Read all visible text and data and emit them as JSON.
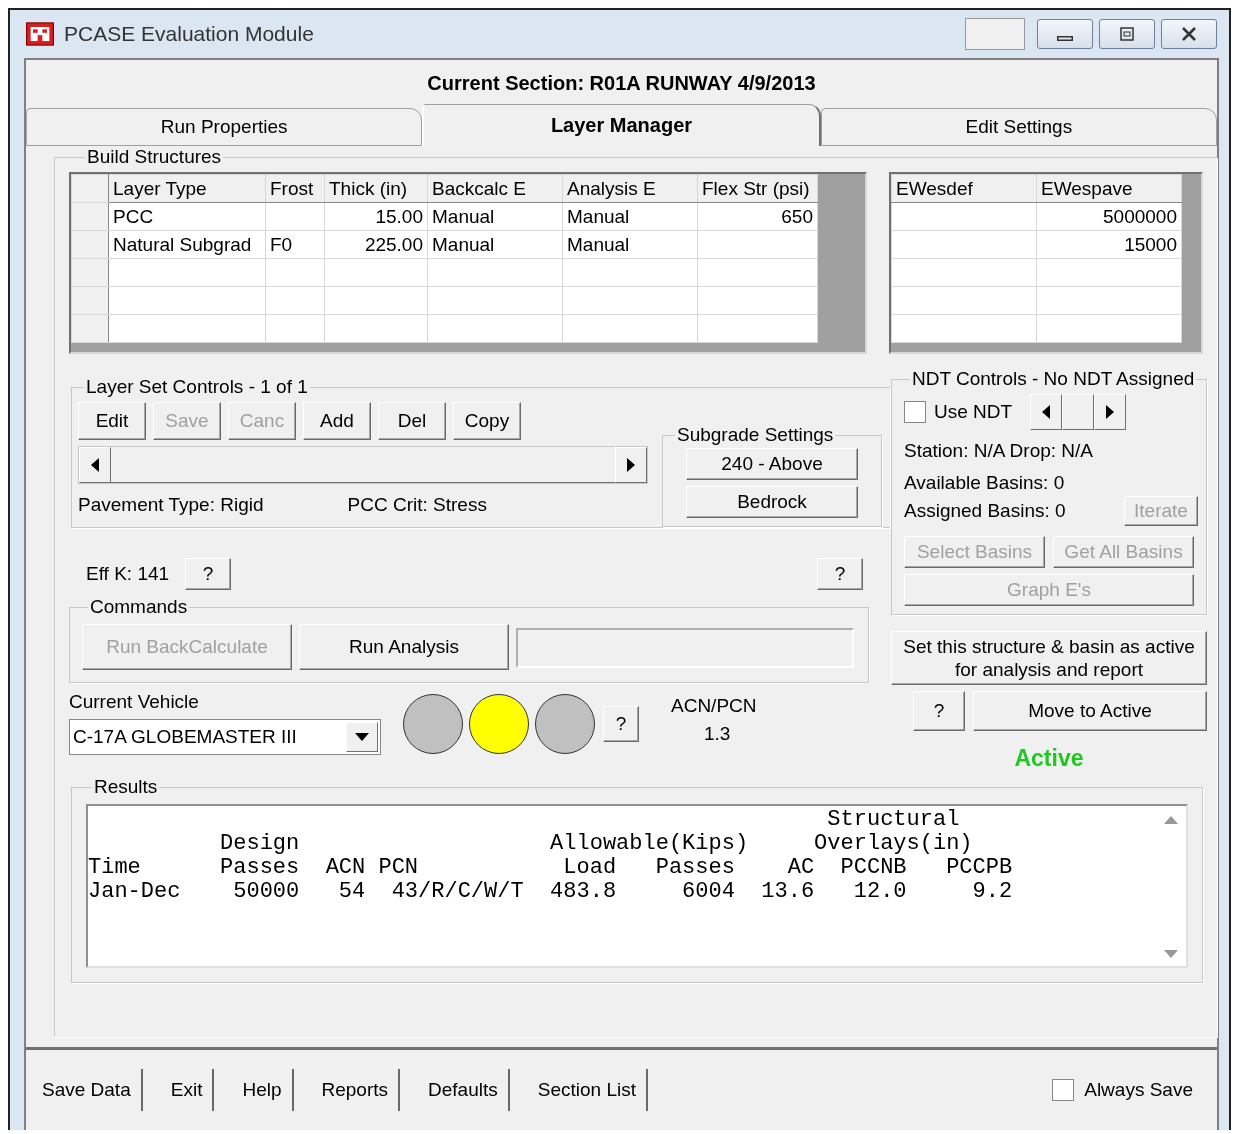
{
  "window": {
    "title": "PCASE Evaluation Module"
  },
  "header": "Current Section: R01A RUNWAY 4/9/2013",
  "tabs": [
    {
      "label": "Run Properties",
      "selected": false
    },
    {
      "label": "Layer Manager",
      "selected": true
    },
    {
      "label": "Edit Settings",
      "selected": false
    }
  ],
  "build_structures": {
    "title": "Build Structures",
    "layer_table": {
      "columns": [
        {
          "label": "Layer Type"
        },
        {
          "label": "Frost"
        },
        {
          "label": "Thick (in)"
        },
        {
          "label": "Backcalc E"
        },
        {
          "label": "Analysis E"
        },
        {
          "label": "Flex Str (psi)"
        }
      ],
      "rows": [
        [
          "PCC",
          null,
          "15.00",
          "Manual",
          "Manual",
          "650"
        ],
        [
          "Natural Subgrad",
          "F0",
          "225.00",
          "Manual",
          "Manual",
          null
        ]
      ]
    },
    "e_table": {
      "columns": [
        {
          "label": "EWesdef"
        },
        {
          "label": "EWespave"
        }
      ],
      "rows": [
        [
          null,
          "5000000"
        ],
        [
          null,
          "15000"
        ]
      ]
    }
  },
  "layer_set_controls": {
    "title": "Layer Set Controls - 1 of 1",
    "buttons": [
      {
        "label": "Edit",
        "disabled": false
      },
      {
        "label": "Save",
        "disabled": true
      },
      {
        "label": "Canc",
        "disabled": true
      },
      {
        "label": "Add",
        "disabled": false
      },
      {
        "label": "Del",
        "disabled": false
      },
      {
        "label": "Copy",
        "disabled": false
      }
    ],
    "pavement_type": "Pavement Type: Rigid",
    "pcc_crit": "PCC Crit: Stress"
  },
  "subgrade_settings": {
    "title": "Subgrade Settings",
    "buttons": [
      "240 - Above",
      "Bedrock"
    ]
  },
  "eff_k": {
    "label": "Eff K: 141",
    "help": "?"
  },
  "help_right": "?",
  "commands": {
    "title": "Commands",
    "buttons": [
      {
        "label": "Run BackCalculate",
        "disabled": true
      },
      {
        "label": "Run Analysis",
        "disabled": false
      }
    ]
  },
  "current_vehicle": {
    "label": "Current Vehicle",
    "value": "C-17A GLOBEMASTER III"
  },
  "lights": [
    {
      "color": "#c0c0c0"
    },
    {
      "color": "#ffff00"
    },
    {
      "color": "#c0c0c0"
    }
  ],
  "lights_help": "?",
  "acn_pcn": {
    "label": "ACN/PCN",
    "value": "1.3"
  },
  "ndt_controls": {
    "title": "NDT Controls - No NDT Assigned",
    "use_ndt": {
      "label": "Use NDT",
      "checked": false
    },
    "station": "Station: N/A Drop: N/A",
    "available": "Available Basins: 0",
    "assigned": "Assigned Basins: 0",
    "iterate": {
      "label": "Iterate",
      "disabled": true
    },
    "buttons": [
      {
        "label": "Select Basins",
        "disabled": true
      },
      {
        "label": "Get All Basins",
        "disabled": true
      },
      {
        "label": "Graph E's",
        "disabled": true
      }
    ]
  },
  "set_active": "Set this structure & basin as active for analysis and report",
  "active_help": "?",
  "move_to_active": "Move to Active",
  "status": "Active",
  "results": {
    "title": "Results",
    "lines": [
      "                                                        Structural",
      "          Design                   Allowable(Kips)     Overlays(in)",
      "Time      Passes  ACN PCN           Load   Passes    AC  PCCNB   PCCPB",
      "Jan-Dec    50000   54  43/R/C/W/T  483.8     6004  13.6   12.0     9.2"
    ]
  },
  "footer": {
    "buttons": [
      "Save Data",
      "Exit",
      "Help",
      "Reports",
      "Defaults",
      "Section List"
    ],
    "always_save": {
      "label": "Always Save",
      "checked": false
    }
  }
}
